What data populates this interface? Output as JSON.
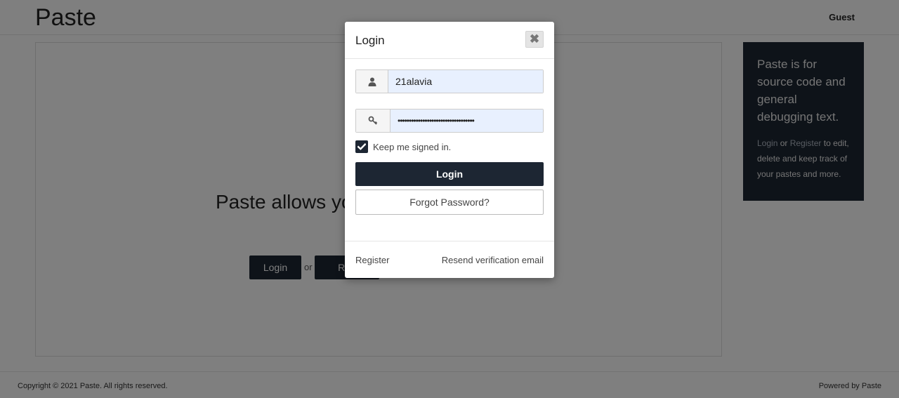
{
  "header": {
    "brand": "Paste",
    "user_label": "Guest"
  },
  "main": {
    "hero_text": "Paste allows yo",
    "login_button": "Login",
    "or_text": "or",
    "register_button": "Reg"
  },
  "sidebar": {
    "headline": "Paste is for source code and general debugging text.",
    "login_link": "Login",
    "or_text": " or ",
    "register_link": "Register",
    "tail_text": " to edit, delete and keep track of your pastes and more."
  },
  "footer": {
    "copyright": "Copyright © 2021 Paste. All rights reserved.",
    "powered_by": "Powered by Paste"
  },
  "modal": {
    "title": "Login",
    "close_symbol": "✖",
    "username": {
      "value": "21alavia",
      "icon": "user-icon"
    },
    "password": {
      "value": "••••••••••••••••••••••••••••••••••",
      "icon": "key-icon"
    },
    "remember": {
      "label": "Keep me signed in.",
      "checked": true
    },
    "login_button": "Login",
    "forgot_button": "Forgot Password?",
    "register_link": "Register",
    "resend_link": "Resend verification email"
  },
  "colors": {
    "primary": "#1d2633",
    "autofill": "#e8f0fe",
    "backdrop": "rgba(0,0,0,0.5)"
  }
}
